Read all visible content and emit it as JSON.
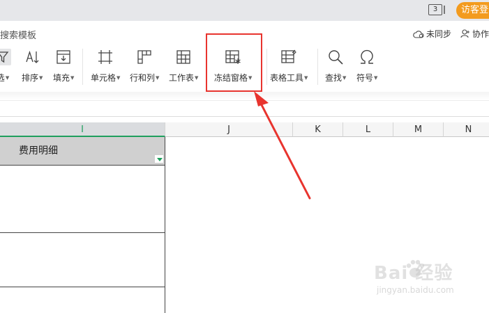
{
  "titlebar": {
    "window_count": "3",
    "visitor_login": "访客登录"
  },
  "topbar": {
    "search_templates": "搜索模板",
    "sync_status": "未同步",
    "collab": "协作"
  },
  "ribbon": {
    "tools": [
      {
        "label": "选",
        "icon": "filter-icon"
      },
      {
        "label": "排序",
        "icon": "sort-icon"
      },
      {
        "label": "填充",
        "icon": "fill-icon"
      },
      {
        "label": "单元格",
        "icon": "cell-icon"
      },
      {
        "label": "行和列",
        "icon": "row-col-icon"
      },
      {
        "label": "工作表",
        "icon": "worksheet-icon"
      },
      {
        "label": "冻结窗格",
        "icon": "freeze-panes-icon"
      },
      {
        "label": "表格工具",
        "icon": "table-tools-icon"
      },
      {
        "label": "查找",
        "icon": "search-icon"
      },
      {
        "label": "符号",
        "icon": "symbol-icon"
      }
    ]
  },
  "sheet": {
    "columns": [
      "I",
      "J",
      "K",
      "L",
      "M",
      "N"
    ],
    "selected_column": "I",
    "header_cell": "费用明细"
  },
  "watermark": {
    "brand": "Bai  经验",
    "url": "jingyan.baidu.com"
  },
  "colors": {
    "accent_orange": "#f39b1e",
    "highlight_red": "#e8342e",
    "excel_green": "#1e9f5d"
  }
}
